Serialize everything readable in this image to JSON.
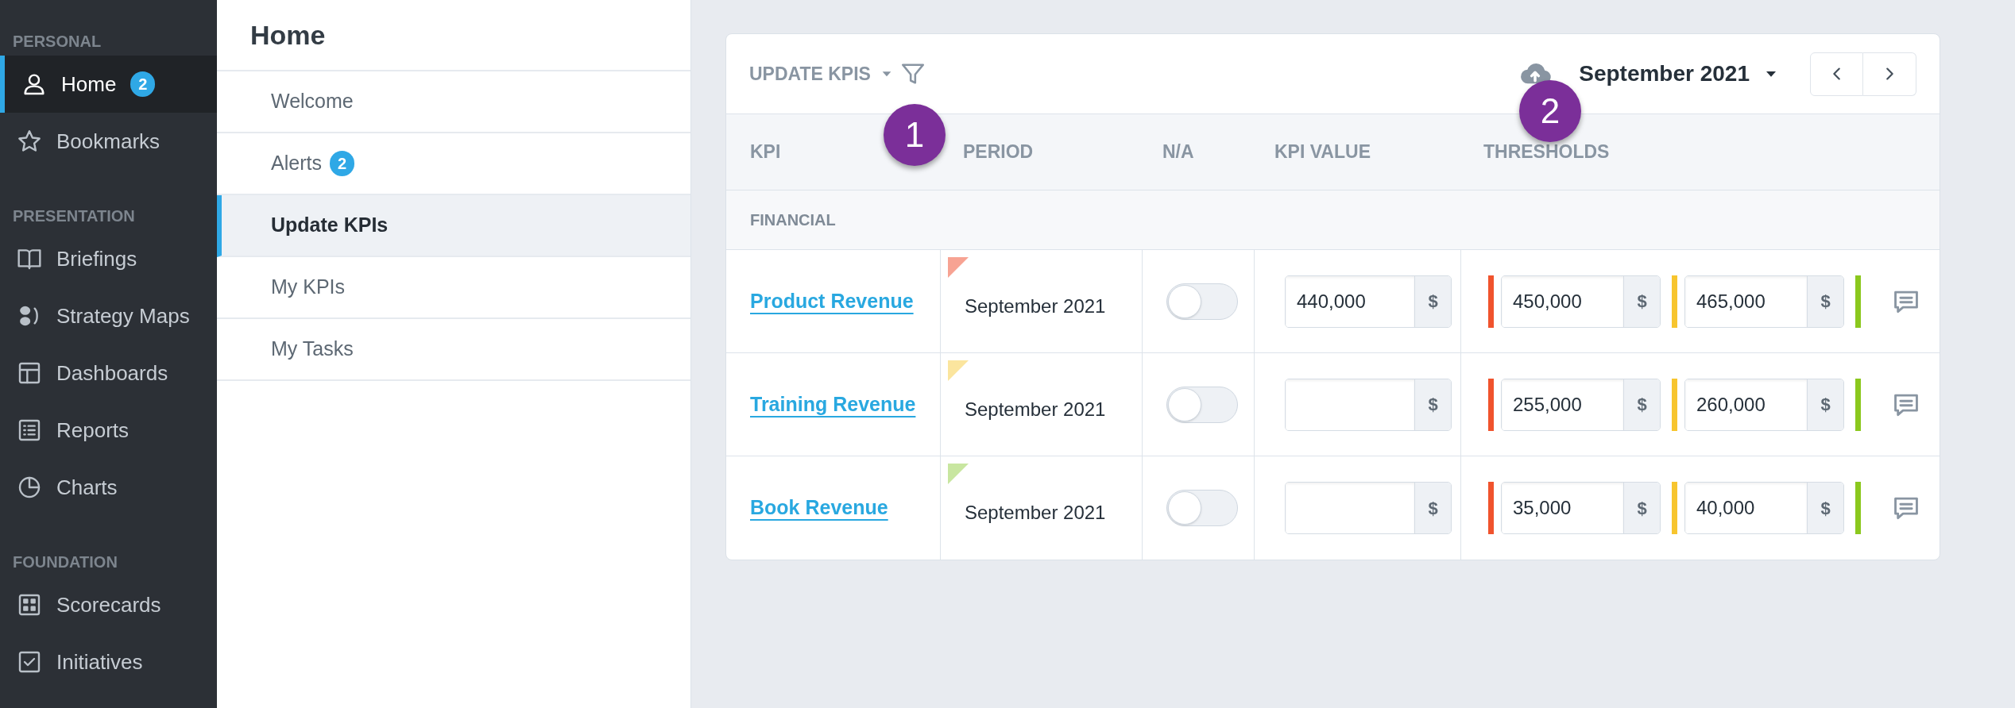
{
  "sidebar": {
    "sections": [
      {
        "title": "PERSONAL",
        "items": [
          {
            "label": "Home",
            "badge": "2",
            "selected": true
          },
          {
            "label": "Bookmarks",
            "selected": false
          }
        ]
      },
      {
        "title": "PRESENTATION",
        "items": [
          {
            "label": "Briefings",
            "selected": false
          },
          {
            "label": "Strategy Maps",
            "selected": false
          },
          {
            "label": "Dashboards",
            "selected": false
          },
          {
            "label": "Reports",
            "selected": false
          },
          {
            "label": "Charts",
            "selected": false
          }
        ]
      },
      {
        "title": "FOUNDATION",
        "items": [
          {
            "label": "Scorecards",
            "selected": false
          },
          {
            "label": "Initiatives",
            "selected": false
          }
        ]
      }
    ]
  },
  "subnav": {
    "title": "Home",
    "items": [
      {
        "label": "Welcome",
        "selected": false
      },
      {
        "label": "Alerts",
        "badge": "2",
        "selected": false
      },
      {
        "label": "Update KPIs",
        "selected": true
      },
      {
        "label": "My KPIs",
        "selected": false
      },
      {
        "label": "My Tasks",
        "selected": false
      }
    ]
  },
  "toolbar": {
    "view": "UPDATE KPIS",
    "period": "September 2021"
  },
  "annotations": [
    "1",
    "2"
  ],
  "table": {
    "columns": [
      "KPI",
      "PERIOD",
      "N/A",
      "KPI VALUE",
      "THRESHOLDS"
    ],
    "group": "FINANCIAL",
    "rows": [
      {
        "kpi": "Product Revenue",
        "color": "#f7a393",
        "period": "September 2021",
        "na": false,
        "value": "440,000",
        "unit": "$",
        "thresholds": [
          {
            "value": "450,000",
            "unit": "$"
          },
          {
            "value": "465,000",
            "unit": "$"
          }
        ]
      },
      {
        "kpi": "Training Revenue",
        "color": "#fbe59e",
        "period": "September 2021",
        "na": false,
        "unit": "$",
        "thresholds": [
          {
            "value": "255,000",
            "unit": "$"
          },
          {
            "value": "260,000",
            "unit": "$"
          }
        ]
      },
      {
        "kpi": "Book Revenue",
        "color": "#c8e6a0",
        "period": "September 2021",
        "na": false,
        "unit": "$",
        "thresholds": [
          {
            "value": "35,000",
            "unit": "$"
          },
          {
            "value": "40,000",
            "unit": "$"
          }
        ]
      }
    ]
  }
}
